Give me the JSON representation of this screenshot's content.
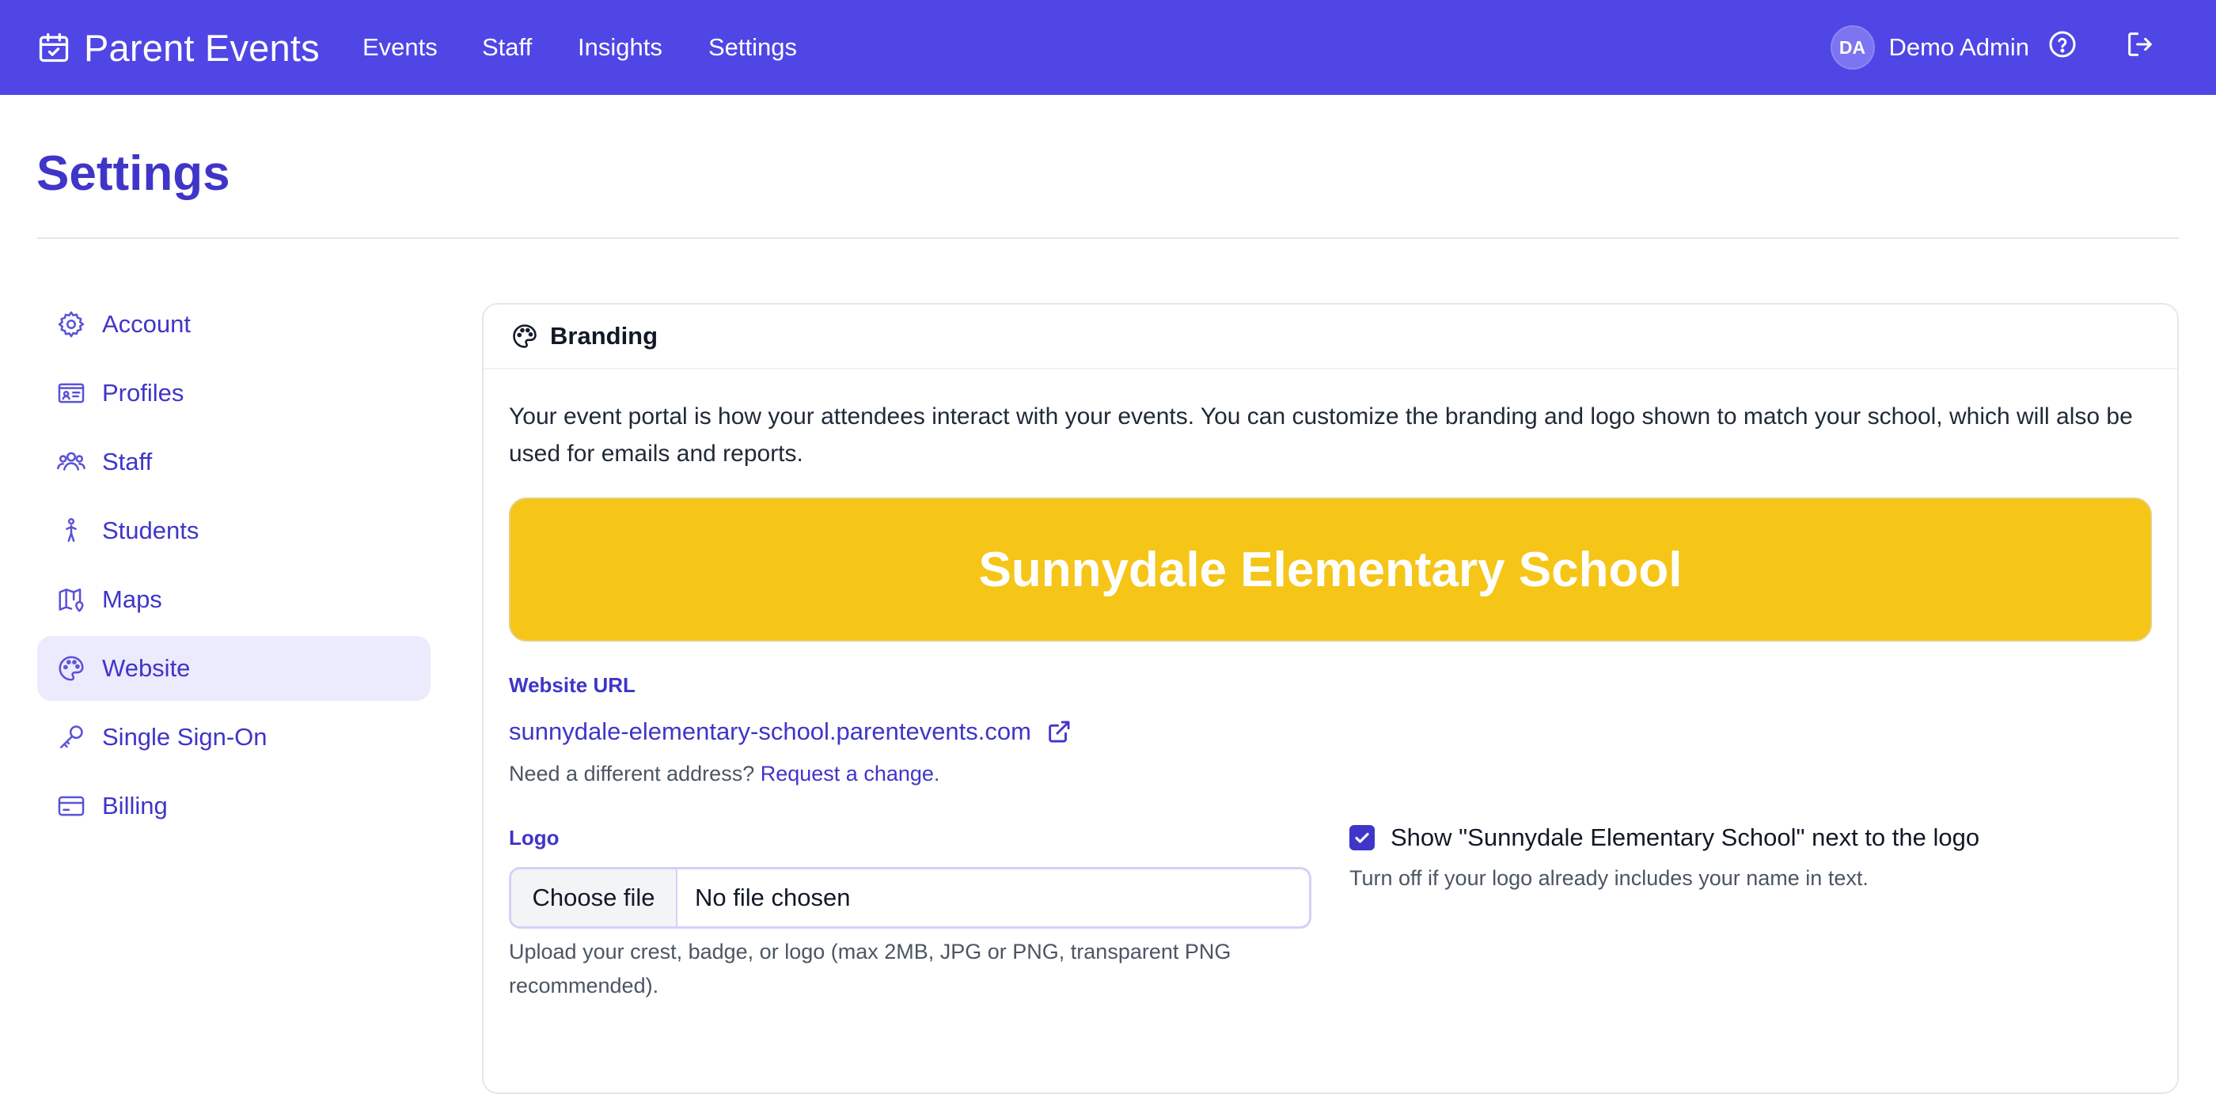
{
  "brand": {
    "name": "Parent Events",
    "color": "#4f46e5",
    "icon": "calendar-check-icon"
  },
  "nav": {
    "items": [
      "Events",
      "Staff",
      "Insights",
      "Settings"
    ]
  },
  "user": {
    "initials": "DA",
    "name": "Demo Admin"
  },
  "page": {
    "title": "Settings"
  },
  "sidebar": {
    "items": [
      {
        "label": "Account",
        "icon": "gear-icon",
        "active": false
      },
      {
        "label": "Profiles",
        "icon": "id-card-icon",
        "active": false
      },
      {
        "label": "Staff",
        "icon": "users-icon",
        "active": false
      },
      {
        "label": "Students",
        "icon": "child-icon",
        "active": false
      },
      {
        "label": "Maps",
        "icon": "map-pin-icon",
        "active": false
      },
      {
        "label": "Website",
        "icon": "palette-icon",
        "active": true
      },
      {
        "label": "Single Sign-On",
        "icon": "key-icon",
        "active": false
      },
      {
        "label": "Billing",
        "icon": "credit-card-icon",
        "active": false
      }
    ]
  },
  "branding": {
    "title": "Branding",
    "intro": "Your event portal is how your attendees interact with your events. You can customize the branding and logo shown to match your school, which will also be used for emails and reports.",
    "banner_text": "Sunnydale Elementary School",
    "banner_color": "#f5c518",
    "website_url_label": "Website URL",
    "website_url": "sunnydale-elementary-school.parentevents.com",
    "different_address_text": "Need a different address?",
    "request_change_link": "Request a change",
    "logo_label": "Logo",
    "choose_file_label": "Choose file",
    "no_file_text": "No file chosen",
    "upload_help": "Upload your crest, badge, or logo (max 2MB, JPG or PNG, transparent PNG recommended).",
    "show_name_checkbox_label": "Show \"Sunnydale Elementary School\" next to the logo",
    "show_name_checked": true,
    "show_name_help": "Turn off if your logo already includes your name in text."
  }
}
